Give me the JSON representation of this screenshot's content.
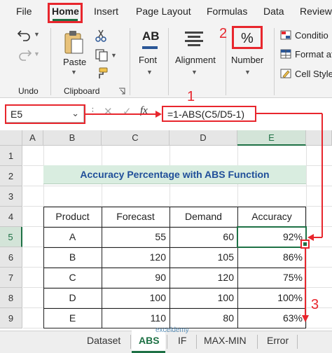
{
  "menu": {
    "items": [
      "File",
      "Home",
      "Insert",
      "Page Layout",
      "Formulas",
      "Data",
      "Review"
    ]
  },
  "ribbon": {
    "undo_label": "Undo",
    "paste_label": "Paste",
    "clipboard_label": "Clipboard",
    "font_label": "Font",
    "alignment_label": "Alignment",
    "number_label": "Number",
    "number_symbol": "%",
    "styles": [
      "Conditional Formatting",
      "Format as Table",
      "Cell Styles"
    ],
    "styles_shown": [
      "Conditio",
      "Format at",
      "Cell Style"
    ]
  },
  "formula_bar": {
    "name_box": "E5",
    "formula": "=1-ABS(C5/D5-1)",
    "fx": "fx"
  },
  "grid": {
    "columns": [
      "A",
      "B",
      "C",
      "D",
      "E"
    ],
    "active_column": "E",
    "rows": [
      "1",
      "2",
      "3",
      "4",
      "5",
      "6",
      "7",
      "8",
      "9"
    ],
    "active_row": "5",
    "title": "Accuracy Percentage with ABS Function",
    "headers": [
      "Product",
      "Forecast",
      "Demand",
      "Accuracy"
    ],
    "data": [
      [
        "A",
        "55",
        "60",
        "92%"
      ],
      [
        "B",
        "120",
        "105",
        "86%"
      ],
      [
        "C",
        "90",
        "120",
        "75%"
      ],
      [
        "D",
        "100",
        "100",
        "100%"
      ],
      [
        "E",
        "110",
        "80",
        "63%"
      ]
    ]
  },
  "sheets": {
    "tabs": [
      "Dataset",
      "ABS",
      "IF",
      "MAX-MIN",
      "Error"
    ],
    "active": "ABS"
  },
  "annotations": {
    "step1": "1",
    "step2": "2",
    "step3": "3",
    "accent": "#e8262d"
  },
  "watermark": "exceldemy"
}
